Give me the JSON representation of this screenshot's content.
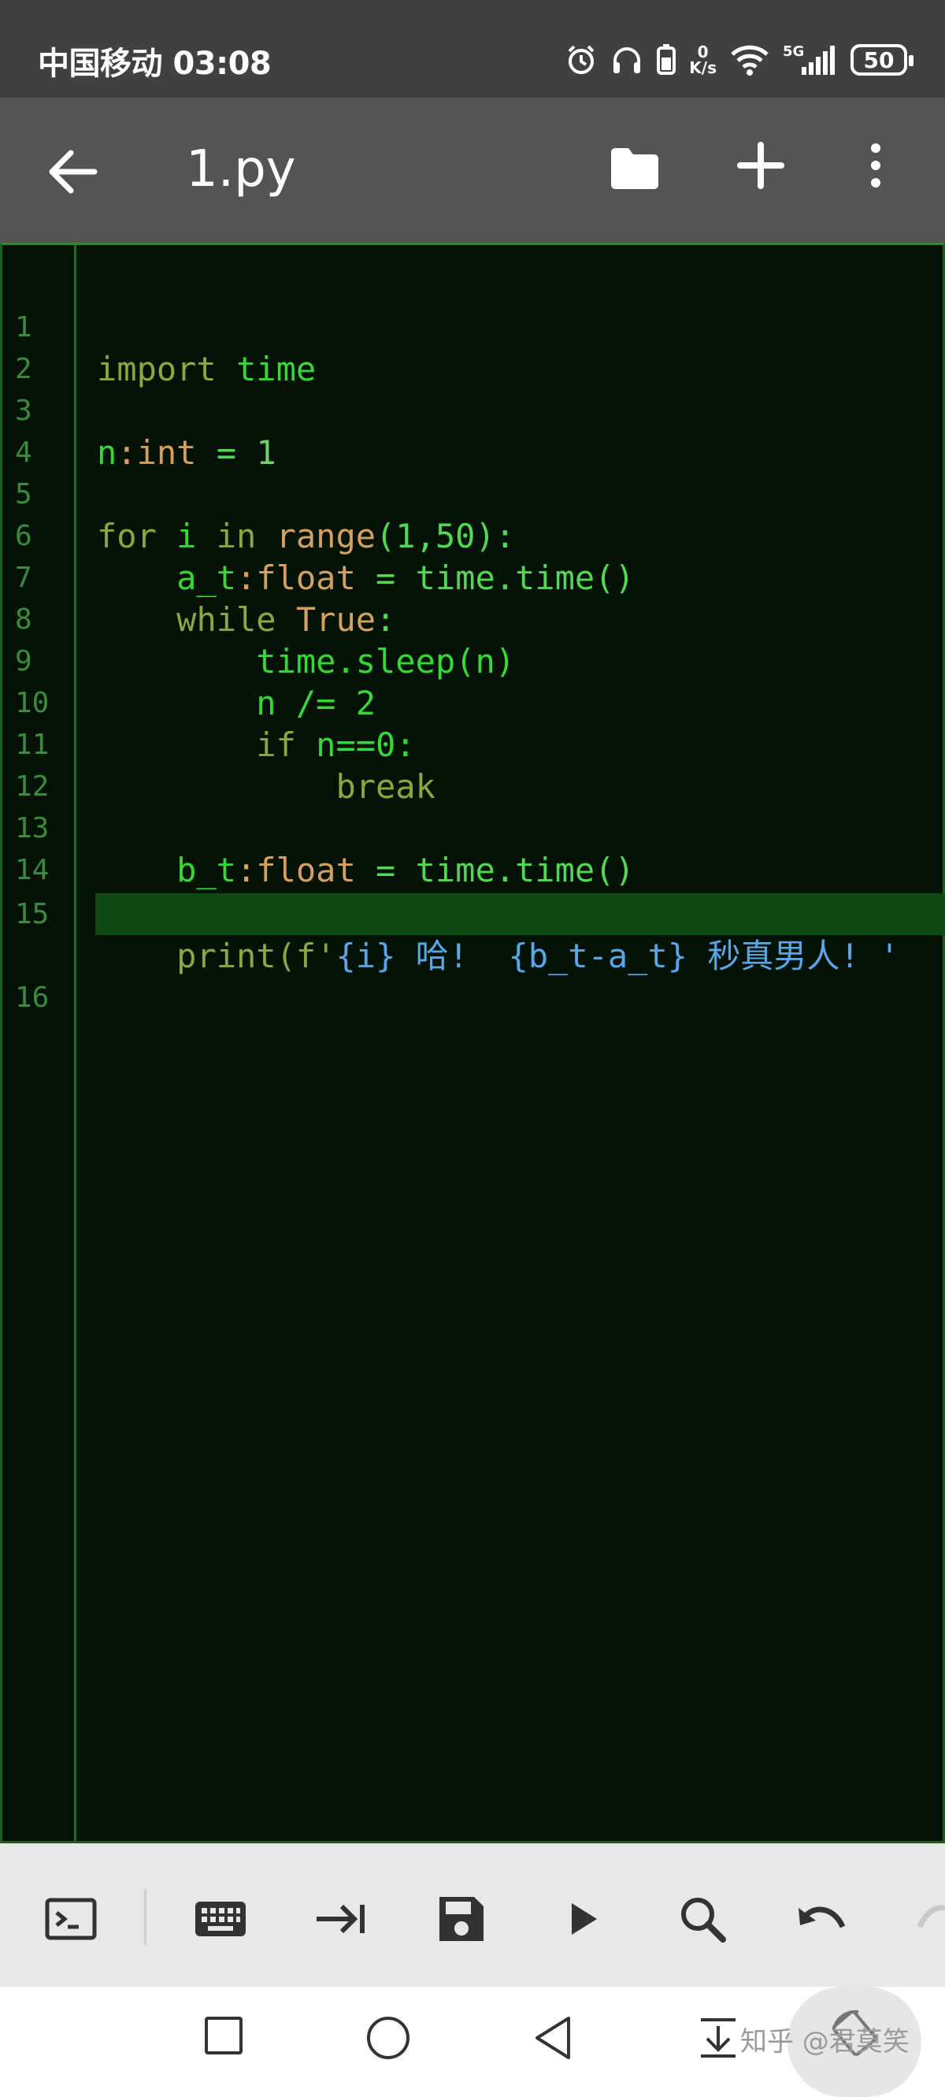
{
  "status_bar": {
    "carrier": "中国移动",
    "time": "03:08",
    "net_speed_value": "0",
    "net_speed_unit": "K/s",
    "network": "5G",
    "battery": "50"
  },
  "app_bar": {
    "title": "1.py"
  },
  "editor": {
    "lines": [
      {
        "num": "1"
      },
      {
        "num": "2"
      },
      {
        "num": "3"
      },
      {
        "num": "4"
      },
      {
        "num": "5"
      },
      {
        "num": "6"
      },
      {
        "num": "7"
      },
      {
        "num": "8"
      },
      {
        "num": "9"
      },
      {
        "num": "10"
      },
      {
        "num": "11"
      },
      {
        "num": "12"
      },
      {
        "num": "13"
      },
      {
        "num": "14"
      },
      {
        "num": "15"
      },
      {
        "num": "16"
      }
    ],
    "code": {
      "l1_kw": "import",
      "l1_id": " time",
      "l3_id": "n",
      "l3_ty": ":int",
      "l3_op": " = ",
      "l3_num": "1",
      "l5_kw1": "for",
      "l5_id": " i ",
      "l5_kw2": "in",
      "l5_ty": " range",
      "l5_rest": "(1,50):",
      "l6_indent": "    ",
      "l6_id": "a_t",
      "l6_ty": ":float",
      "l6_rest": " = time.time()",
      "l7_indent": "    ",
      "l7_kw": "while",
      "l7_ty": " True",
      "l7_rest": ":",
      "l8_indent": "        ",
      "l8_id": "time.sleep(n)",
      "l9_indent": "        ",
      "l9_id": "n /= 2",
      "l10_indent": "        ",
      "l10_kw": "if",
      "l10_rest": " n==0:",
      "l11_indent": "            ",
      "l11_kw": "break",
      "l13_indent": "    ",
      "l13_id": "b_t",
      "l13_ty": ":float",
      "l13_rest": " = time.time()",
      "l15_indent": "    ",
      "l15_kw": "print",
      "l15_paren": "(f'",
      "l15_str": "{i} 哈!  {b_t-a_t} 秒真男人! '"
    },
    "current_line": 16
  },
  "toolbar": {
    "items": [
      "terminal-icon",
      "keyboard-icon",
      "tab-indent-icon",
      "save-icon",
      "run-icon",
      "search-icon",
      "undo-icon",
      "redo-icon"
    ]
  },
  "nav_bar": {
    "watermark": "知乎 @君莫笑"
  },
  "colors": {
    "status_bg": "#414141",
    "appbar_bg": "#545454",
    "editor_bg": "#021204",
    "current_line_bg": "#0e4a14",
    "toolbar_bg": "#e8e8e8"
  }
}
